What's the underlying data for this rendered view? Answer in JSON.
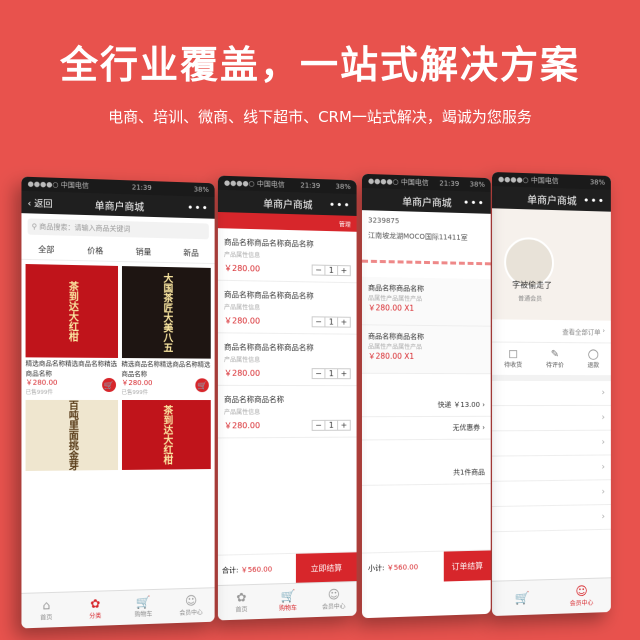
{
  "headline": "全行业覆盖，一站式解决方案",
  "subline": "电商、培训、微商、线下超市、CRM一站式解决，竭诚为您服务",
  "status": {
    "carrier": "●●●●○ 中国电信",
    "time": "21:39",
    "battery": "38%"
  },
  "phone1": {
    "back": "返回",
    "title": "单商户商城",
    "more": "•••",
    "search_placeholder": "商品搜索：请输入商品关键词",
    "filters": [
      "全部",
      "价格",
      "销量",
      "新品"
    ],
    "products": [
      {
        "name": "精选商品名称精选商品名称精选商品名称",
        "price": "￥280.00",
        "sold": "已售999件",
        "art": "茶到达大红柑"
      },
      {
        "name": "精选商品名称精选商品名称精选商品名称",
        "price": "￥280.00",
        "sold": "已售999件",
        "art": "大国茶匠大美八五"
      },
      {
        "name": "",
        "price": "",
        "sold": "",
        "art": "百吨里面挑金芽"
      },
      {
        "name": "",
        "price": "",
        "sold": "",
        "art": "茶到达大红柑"
      }
    ],
    "tabs": [
      "首页",
      "分类",
      "购物车",
      "会员中心"
    ]
  },
  "phone2": {
    "title": "单商户商城",
    "manage": "管理",
    "items": [
      {
        "name": "商品名称商品名称商品名称",
        "attr": "产品属性信息",
        "price": "￥280.00",
        "qty": "1"
      },
      {
        "name": "商品名称商品名称商品名称",
        "attr": "产品属性信息",
        "price": "￥280.00",
        "qty": "1"
      },
      {
        "name": "商品名称商品名称商品名称",
        "attr": "产品属性信息",
        "price": "￥280.00",
        "qty": "1"
      },
      {
        "name": "商品名称商品名称",
        "attr": "产品属性信息",
        "price": "￥280.00",
        "qty": "1"
      }
    ],
    "total_label": "合计:",
    "total": "￥560.00",
    "pay": "立即结算",
    "tabs": [
      "首页",
      "购物车",
      "会员中心"
    ]
  },
  "phone3": {
    "title": "单商户商城",
    "phone": "3239875",
    "address": "江南坡龙湖MOCO国际11411室",
    "items": [
      {
        "name": "商品名称商品名称",
        "attr": "品属性产品属性产品",
        "price": "￥280.00 X1"
      },
      {
        "name": "商品名称商品名称",
        "attr": "品属性产品属性产品",
        "price": "￥280.00 X1"
      }
    ],
    "shipping_label": "快递",
    "shipping": "￥13.00",
    "coupon": "无优惠券",
    "count": "共1件商品",
    "subtotal_label": "小计:",
    "subtotal": "￥560.00",
    "submit": "订单结算"
  },
  "phone4": {
    "title": "单商户商城",
    "nickname": "字被偷走了",
    "level": "普通会员",
    "all_orders": "查看全部订单",
    "order_states": [
      "待收货",
      "待评价",
      "退款"
    ],
    "tabs": [
      "会员中心"
    ]
  }
}
